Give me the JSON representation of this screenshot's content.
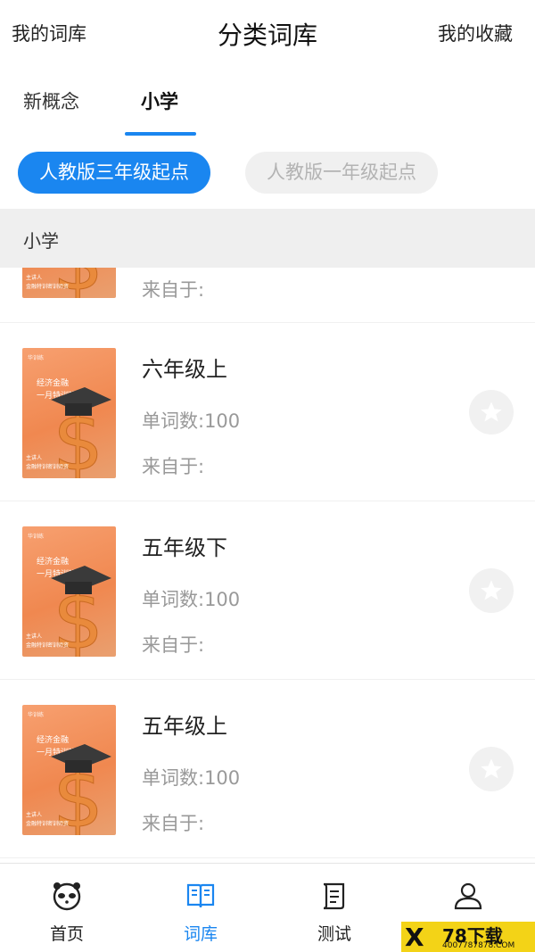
{
  "header": {
    "left_label": "我的词库",
    "title": "分类词库",
    "right_label": "我的收藏"
  },
  "tabs": [
    {
      "label": "新概念",
      "selected": false
    },
    {
      "label": "小学",
      "selected": true
    }
  ],
  "chips": [
    {
      "label": "人教版三年级起点",
      "selected": true
    },
    {
      "label": "人教版一年级起点",
      "selected": false
    }
  ],
  "section": {
    "title": "小学"
  },
  "cover": {
    "brand": "华训练",
    "line1": "经济金融",
    "line2": "一月特训班",
    "line3": "主讲人",
    "line4": "金融特训密训师资"
  },
  "books": [
    {
      "name": "",
      "count_label": "",
      "source_label": "来自于:"
    },
    {
      "name": "六年级上",
      "count_label": "单词数:100",
      "source_label": "来自于:"
    },
    {
      "name": "五年级下",
      "count_label": "单词数:100",
      "source_label": "来自于:"
    },
    {
      "name": "五年级上",
      "count_label": "单词数:100",
      "source_label": "来自于:"
    }
  ],
  "bottom_nav": [
    {
      "label": "首页",
      "icon": "panda-icon",
      "active": false
    },
    {
      "label": "词库",
      "icon": "book-icon",
      "active": true
    },
    {
      "label": "测试",
      "icon": "scroll-icon",
      "active": false
    },
    {
      "label": "",
      "icon": "user-icon",
      "active": false
    }
  ],
  "watermark": {
    "mark": "X",
    "title": "78下载",
    "url": "4007787878.COM"
  },
  "colors": {
    "accent": "#1a86f0",
    "cover": "#f08850",
    "watermark": "#f3d317"
  }
}
